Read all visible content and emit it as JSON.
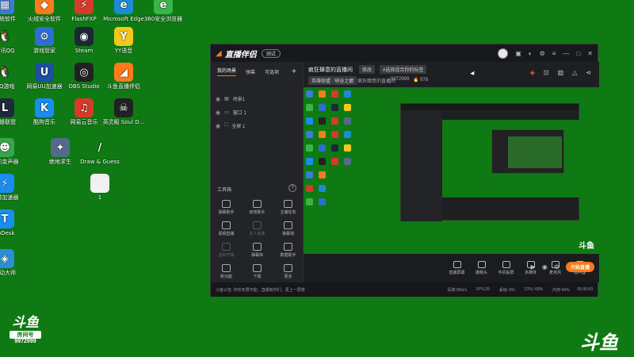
{
  "desktop": {
    "icons": [
      {
        "label": "系统软件",
        "glyph": "▦",
        "color": "#3a7bd5"
      },
      {
        "label": "火绒安全软件",
        "glyph": "◆",
        "color": "#ff7a1a"
      },
      {
        "label": "FlashFXP",
        "glyph": "⚡",
        "color": "#d63a2a"
      },
      {
        "label": "Microsoft Edge",
        "glyph": "e",
        "color": "#1c8bd6"
      },
      {
        "label": "360安全浏览器",
        "glyph": "e",
        "color": "#3bb54a"
      },
      {
        "label": "腾讯QQ",
        "glyph": "🐧",
        "color": "#0f7a14"
      },
      {
        "label": "游戏管家",
        "glyph": "⚙",
        "color": "#2d6fd1"
      },
      {
        "label": "Steam",
        "glyph": "◉",
        "color": "#1b2838"
      },
      {
        "label": "YY语音",
        "glyph": "Y",
        "color": "#f5c71a"
      },
      {
        "label": "QQ游戏",
        "glyph": "🐧",
        "color": "#0f7a14"
      },
      {
        "label": "网易UU加速器",
        "glyph": "U",
        "color": "#1c4fa3"
      },
      {
        "label": "OBS Studio",
        "glyph": "◎",
        "color": "#222222"
      },
      {
        "label": "斗鱼直播伴侣",
        "glyph": "◢",
        "color": "#ff7a1a"
      },
      {
        "label": "英雄联盟",
        "glyph": "L",
        "color": "#1d2a3a"
      },
      {
        "label": "酷狗音乐",
        "glyph": "K",
        "color": "#1a8ef0"
      },
      {
        "label": "网易云音乐",
        "glyph": "♫",
        "color": "#d63a2a"
      },
      {
        "label": "英灵殿 Soul D...",
        "glyph": "☠",
        "color": "#222222"
      },
      {
        "label": "腾讯变声器",
        "glyph": "☻",
        "color": "#3aa64a"
      },
      {
        "label": "绝地求生",
        "glyph": "✦",
        "color": "#556b8a"
      },
      {
        "label": "Draw & Guess",
        "glyph": "/",
        "color": "#0f7a14"
      },
      {
        "label": "1",
        "glyph": " ",
        "color": "#f1f1f1"
      },
      {
        "label": "迅游加速器",
        "glyph": "⚡",
        "color": "#1a8ef0"
      },
      {
        "label": "ToDesk",
        "glyph": "T",
        "color": "#1a8ef0"
      },
      {
        "label": "驱动大师",
        "glyph": "◈",
        "color": "#2a8fd6"
      }
    ],
    "watermark_left": {
      "logo": "斗鱼",
      "room_label": "房间号",
      "room_number": "9972999"
    },
    "watermark_right": "斗鱼"
  },
  "app": {
    "logo_text": "直播伴侣",
    "badge": "测试",
    "left_tabs": [
      "我的场景",
      "弹幕",
      "可选项"
    ],
    "add_scene": "+",
    "scenes": [
      "场景1",
      "窗口 1",
      "全屏 1"
    ],
    "tools_title": "工具箱",
    "tools": [
      {
        "label": "弹幕助手",
        "dim": false
      },
      {
        "label": "房管助手",
        "dim": false
      },
      {
        "label": "主播任务",
        "dim": false
      },
      {
        "label": "视频直播",
        "dim": false
      },
      {
        "label": "多人连麦",
        "dim": true
      },
      {
        "label": "弹幕墙",
        "dim": false
      },
      {
        "label": "虚拟开播",
        "dim": true
      },
      {
        "label": "弹幕库",
        "dim": false
      },
      {
        "label": "数据助手",
        "dim": false
      },
      {
        "label": "新功能",
        "dim": false
      },
      {
        "label": "下载",
        "dim": false
      },
      {
        "label": "更多",
        "dim": false
      }
    ],
    "room_title": "疯狂肆意的直播间",
    "edit_chip": "修改",
    "category_chip": "#选择适合你的标签",
    "game_chip": "英雄联盟 · 峡谷之巅",
    "room_meta": "疯狂肆意的直播间",
    "room_id": "9972999",
    "heat": "978",
    "bottom_tools": [
      "直播屏幕",
      "摄像头",
      "手机投屏",
      "多媒体",
      "麦克风",
      "扬声器"
    ],
    "go_live": "开始直播",
    "preview_watermark": "斗鱼",
    "status_notice": "斗鱼公告: 你你无限可能，直播有你们，更上一层楼",
    "stats": [
      "码率:0Kb/s",
      "FPS:29",
      "丢帧: 0%",
      "CPU: 66%",
      "内存:44%"
    ],
    "timer": "00:00:00"
  }
}
